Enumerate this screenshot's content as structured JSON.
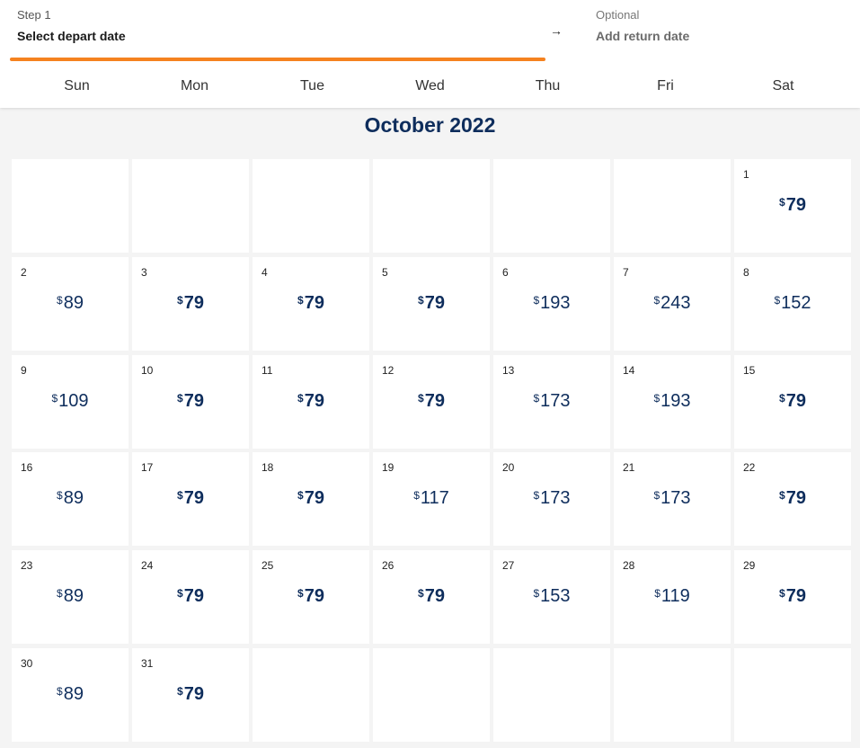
{
  "header": {
    "step1": {
      "label": "Step 1",
      "title": "Select depart date"
    },
    "arrow_icon": "arrow-right-icon",
    "step2": {
      "label": "Optional",
      "title": "Add return date"
    },
    "accent_color": "#f5821f"
  },
  "weekdays": [
    "Sun",
    "Mon",
    "Tue",
    "Wed",
    "Thu",
    "Fri",
    "Sat"
  ],
  "calendar": {
    "month_title": "October 2022",
    "leading_blanks": 6,
    "currency": "$",
    "lowest_fare": "79",
    "days": [
      {
        "day": "1",
        "price": "79"
      },
      {
        "day": "2",
        "price": "89"
      },
      {
        "day": "3",
        "price": "79"
      },
      {
        "day": "4",
        "price": "79"
      },
      {
        "day": "5",
        "price": "79"
      },
      {
        "day": "6",
        "price": "193"
      },
      {
        "day": "7",
        "price": "243"
      },
      {
        "day": "8",
        "price": "152"
      },
      {
        "day": "9",
        "price": "109"
      },
      {
        "day": "10",
        "price": "79"
      },
      {
        "day": "11",
        "price": "79"
      },
      {
        "day": "12",
        "price": "79"
      },
      {
        "day": "13",
        "price": "173"
      },
      {
        "day": "14",
        "price": "193"
      },
      {
        "day": "15",
        "price": "79"
      },
      {
        "day": "16",
        "price": "89"
      },
      {
        "day": "17",
        "price": "79"
      },
      {
        "day": "18",
        "price": "79"
      },
      {
        "day": "19",
        "price": "117"
      },
      {
        "day": "20",
        "price": "173"
      },
      {
        "day": "21",
        "price": "173"
      },
      {
        "day": "22",
        "price": "79"
      },
      {
        "day": "23",
        "price": "89"
      },
      {
        "day": "24",
        "price": "79"
      },
      {
        "day": "25",
        "price": "79"
      },
      {
        "day": "26",
        "price": "79"
      },
      {
        "day": "27",
        "price": "153"
      },
      {
        "day": "28",
        "price": "119"
      },
      {
        "day": "29",
        "price": "79"
      },
      {
        "day": "30",
        "price": "89"
      },
      {
        "day": "31",
        "price": "79"
      }
    ]
  }
}
